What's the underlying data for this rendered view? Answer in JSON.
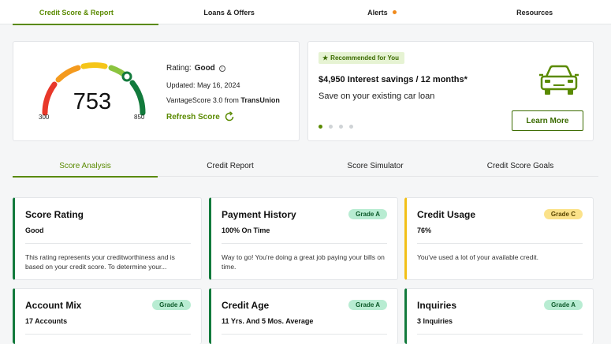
{
  "top_nav": {
    "tabs": [
      {
        "label": "Credit Score & Report"
      },
      {
        "label": "Loans & Offers"
      },
      {
        "label": "Alerts"
      },
      {
        "label": "Resources"
      }
    ]
  },
  "score_card": {
    "score": "753",
    "min": "300",
    "max": "850",
    "rating_label": "Rating:",
    "rating_value": "Good",
    "updated": "Updated: May 16, 2024",
    "model_prefix": "VantageScore 3.0 from",
    "bureau": "TransUnion",
    "refresh_label": "Refresh Score"
  },
  "recommendation": {
    "badge": "Recommended for You",
    "title": "$4,950 Interest savings / 12 months*",
    "subtitle": "Save on your existing car loan",
    "button": "Learn More",
    "icon": "car-icon",
    "pages": 4,
    "current_page": 1
  },
  "sub_nav": {
    "tabs": [
      {
        "label": "Score Analysis"
      },
      {
        "label": "Credit Report"
      },
      {
        "label": "Score Simulator"
      },
      {
        "label": "Credit Score Goals"
      }
    ]
  },
  "analysis": [
    {
      "title": "Score Rating",
      "value": "Good",
      "grade": "",
      "description": "This rating represents your creditworthiness and is based on your credit score. To determine your..."
    },
    {
      "title": "Payment History",
      "value": "100% On Time",
      "grade": "Grade A",
      "description": "Way to go! You're doing a great job paying your bills on time."
    },
    {
      "title": "Credit Usage",
      "value": "76%",
      "grade": "Grade C",
      "description": "You've used a lot of your available credit."
    },
    {
      "title": "Account Mix",
      "value": "17 Accounts",
      "grade": "Grade A",
      "description": ""
    },
    {
      "title": "Credit Age",
      "value": "11 Yrs. And 5 Mos. Average",
      "grade": "Grade A",
      "description": ""
    },
    {
      "title": "Inquiries",
      "value": "3 Inquiries",
      "grade": "Grade A",
      "description": ""
    }
  ],
  "colors": {
    "accent": "#5a8a00",
    "grade_a": "#b8ecd2",
    "grade_c": "#fbe28a",
    "card_good": "#127a3c",
    "card_warn": "#f2c018",
    "alert_dot": "#f08a1c"
  }
}
